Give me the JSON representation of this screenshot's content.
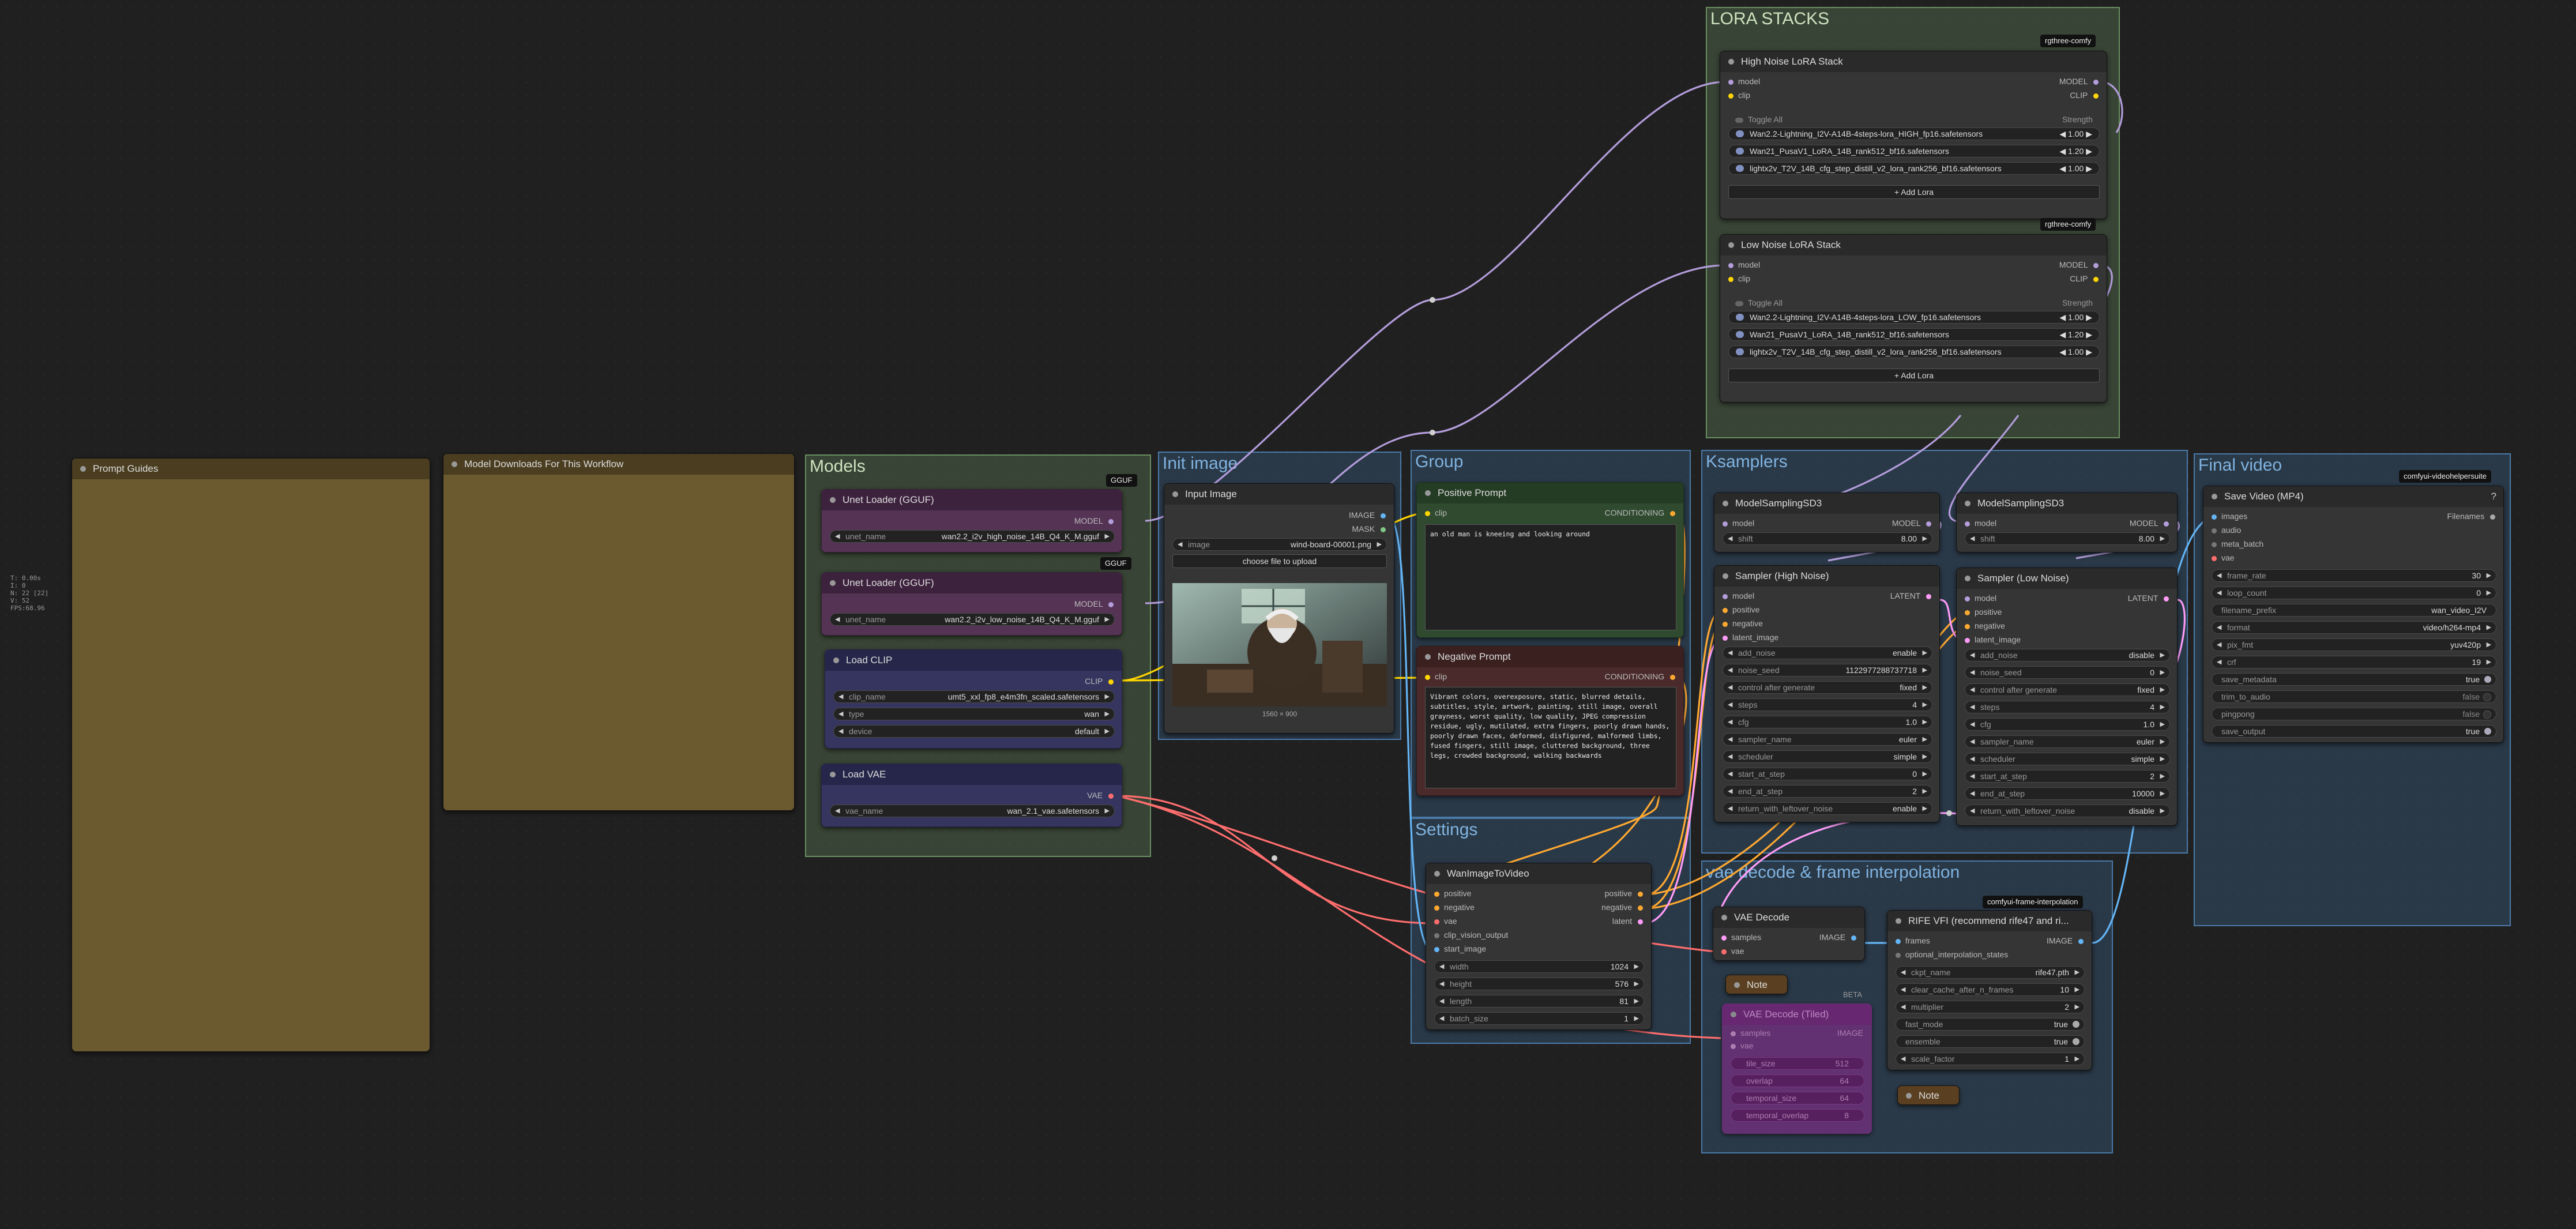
{
  "stats": {
    "l1": "T: 0.00s",
    "l2": "I: 0",
    "l3": "N: 22 [22]",
    "l4": "V: 52",
    "l5": "FPS:68.96"
  },
  "groups": {
    "lora": "LORA STACKS",
    "models": "Models",
    "init": "Init image",
    "group": "Group",
    "ksamplers": "Ksamplers",
    "final": "Final video",
    "settings": "Settings",
    "decode": "vae decode & frame interpolation"
  },
  "nodes": {
    "prompt_guides": "Prompt Guides",
    "model_downloads": "Model Downloads For This Workflow",
    "unet_high": {
      "title": "Unet Loader (GGUF)",
      "badge": "GGUF",
      "out": "MODEL",
      "w_label": "unet_name",
      "w_value": "wan2.2_i2v_high_noise_14B_Q4_K_M.gguf"
    },
    "unet_low": {
      "title": "Unet Loader (GGUF)",
      "badge": "GGUF",
      "out": "MODEL",
      "w_label": "unet_name",
      "w_value": "wan2.2_i2v_low_noise_14B_Q4_K_M.gguf"
    },
    "load_clip": {
      "title": "Load CLIP",
      "out": "CLIP",
      "clip_label": "clip_name",
      "clip_value": "umt5_xxl_fp8_e4m3fn_scaled.safetensors",
      "type_label": "type",
      "type_value": "wan",
      "device_label": "device",
      "device_value": "default"
    },
    "load_vae": {
      "title": "Load VAE",
      "out": "VAE",
      "w_label": "vae_name",
      "w_value": "wan_2.1_vae.safetensors"
    },
    "input_image": {
      "title": "Input Image",
      "out1": "IMAGE",
      "out2": "MASK",
      "w_label": "image",
      "w_value": "wind-board-00001.png",
      "button": "choose file to upload",
      "size": "1560 × 900"
    },
    "pos_prompt": {
      "title": "Positive Prompt",
      "in": "clip",
      "out": "CONDITIONING",
      "text": "an old man is kneeing and looking around"
    },
    "neg_prompt": {
      "title": "Negative Prompt",
      "in": "clip",
      "out": "CONDITIONING",
      "text": "Vibrant colors, overexposure, static, blurred details, subtitles, style, artwork, painting, still image, overall grayness, worst quality, low quality, JPEG compression residue, ugly, mutilated, extra fingers, poorly drawn hands, poorly drawn faces, deformed, disfigured, malformed limbs, fused fingers, still image, cluttered background, three legs, crowded background, walking backwards"
    },
    "high_lora": {
      "title": "High Noise LoRA Stack",
      "badge": "rgthree-comfy",
      "in1": "model",
      "in2": "clip",
      "out1": "MODEL",
      "out2": "CLIP",
      "toggle": "Toggle All",
      "strength": "Strength",
      "rows": [
        {
          "name": "Wan2.2-Lightning_I2V-A14B-4steps-lora_HIGH_fp16.safetensors",
          "value": "1.00"
        },
        {
          "name": "Wan21_PusaV1_LoRA_14B_rank512_bf16.safetensors",
          "value": "1.20"
        },
        {
          "name": "lightx2v_T2V_14B_cfg_step_distill_v2_lora_rank256_bf16.safetensors",
          "value": "1.00"
        }
      ],
      "add": "+ Add Lora"
    },
    "low_lora": {
      "title": "Low Noise LoRA Stack",
      "badge": "rgthree-comfy",
      "in1": "model",
      "in2": "clip",
      "out1": "MODEL",
      "out2": "CLIP",
      "toggle": "Toggle All",
      "strength": "Strength",
      "rows": [
        {
          "name": "Wan2.2-Lightning_I2V-A14B-4steps-lora_LOW_fp16.safetensors",
          "value": "1.00"
        },
        {
          "name": "Wan21_PusaV1_LoRA_14B_rank512_bf16.safetensors",
          "value": "1.20"
        },
        {
          "name": "lightx2v_T2V_14B_cfg_step_distill_v2_lora_rank256_bf16.safetensors",
          "value": "1.00"
        }
      ],
      "add": "+ Add Lora"
    },
    "msd_high": {
      "title": "ModelSamplingSD3",
      "in": "model",
      "out": "MODEL",
      "w_label": "shift",
      "w_value": "8.00"
    },
    "msd_low": {
      "title": "ModelSamplingSD3",
      "in": "model",
      "out": "MODEL",
      "w_label": "shift",
      "w_value": "8.00"
    },
    "sampler_high": {
      "title": "Sampler (High Noise)",
      "inputs": [
        "model",
        "positive",
        "negative",
        "latent_image"
      ],
      "out": "LATENT",
      "widgets": [
        [
          "add_noise",
          "enable"
        ],
        [
          "noise_seed",
          "1122977288737718"
        ],
        [
          "control after generate",
          "fixed"
        ],
        [
          "steps",
          "4"
        ],
        [
          "cfg",
          "1.0"
        ],
        [
          "sampler_name",
          "euler"
        ],
        [
          "scheduler",
          "simple"
        ],
        [
          "start_at_step",
          "0"
        ],
        [
          "end_at_step",
          "2"
        ],
        [
          "return_with_leftover_noise",
          "enable"
        ]
      ]
    },
    "sampler_low": {
      "title": "Sampler (Low Noise)",
      "inputs": [
        "model",
        "positive",
        "negative",
        "latent_image"
      ],
      "out": "LATENT",
      "widgets": [
        [
          "add_noise",
          "disable"
        ],
        [
          "noise_seed",
          "0"
        ],
        [
          "control after generate",
          "fixed"
        ],
        [
          "steps",
          "4"
        ],
        [
          "cfg",
          "1.0"
        ],
        [
          "sampler_name",
          "euler"
        ],
        [
          "scheduler",
          "simple"
        ],
        [
          "start_at_step",
          "2"
        ],
        [
          "end_at_step",
          "10000"
        ],
        [
          "return_with_leftover_noise",
          "disable"
        ]
      ]
    },
    "wan_i2v": {
      "title": "WanImageToVideo",
      "inputs": [
        "positive",
        "negative",
        "vae",
        "clip_vision_output",
        "start_image"
      ],
      "outputs": [
        "positive",
        "negative",
        "latent"
      ],
      "widgets": [
        [
          "width",
          "1024"
        ],
        [
          "height",
          "576"
        ],
        [
          "length",
          "81"
        ],
        [
          "batch_size",
          "1"
        ]
      ]
    },
    "vae_decode": {
      "title": "VAE Decode",
      "inputs": [
        "samples",
        "vae"
      ],
      "out": "IMAGE"
    },
    "note1": "Note",
    "note2": "Note",
    "vae_tiled": {
      "title": "VAE Decode (Tiled)",
      "beta": "BETA",
      "in1": "samples",
      "in2": "vae",
      "out": "IMAGE",
      "widgets": [
        [
          "tile_size",
          "512"
        ],
        [
          "overlap",
          "64"
        ],
        [
          "temporal_size",
          "64"
        ],
        [
          "temporal_overlap",
          "8"
        ]
      ]
    },
    "rife": {
      "title": "RIFE VFI (recommend rife47 and ri...",
      "badge": "comfyui-frame-interpolation",
      "inputs": [
        "frames",
        "optional_interpolation_states"
      ],
      "out": "IMAGE",
      "widgets": [
        [
          "ckpt_name",
          "rife47.pth"
        ],
        [
          "clear_cache_after_n_frames",
          "10"
        ],
        [
          "multiplier",
          "2"
        ],
        [
          "fast_mode",
          "true"
        ],
        [
          "ensemble",
          "true"
        ],
        [
          "scale_factor",
          "1"
        ]
      ]
    },
    "save_video": {
      "title": "Save Video (MP4)",
      "badge": "comfyui-videohelpersuite",
      "inputs": [
        "images",
        "audio",
        "meta_batch",
        "vae"
      ],
      "out": "Filenames",
      "help": "?",
      "widgets": [
        [
          "frame_rate",
          "30"
        ],
        [
          "loop_count",
          "0"
        ],
        [
          "filename_prefix",
          "wan_video_I2V"
        ],
        [
          "format",
          "video/h264-mp4"
        ],
        [
          "pix_fmt",
          "yuv420p"
        ],
        [
          "crf",
          "19"
        ],
        [
          "save_metadata",
          "true"
        ],
        [
          "trim_to_audio",
          "false"
        ],
        [
          "pingpong",
          "false"
        ],
        [
          "save_output",
          "true"
        ]
      ]
    }
  },
  "colors": {
    "model": "#b39ddb",
    "clip": "#ffd600",
    "vae": "#ff6e6e",
    "cond": "#ffa931",
    "latent": "#ff9cf9",
    "image": "#64b5f6"
  }
}
